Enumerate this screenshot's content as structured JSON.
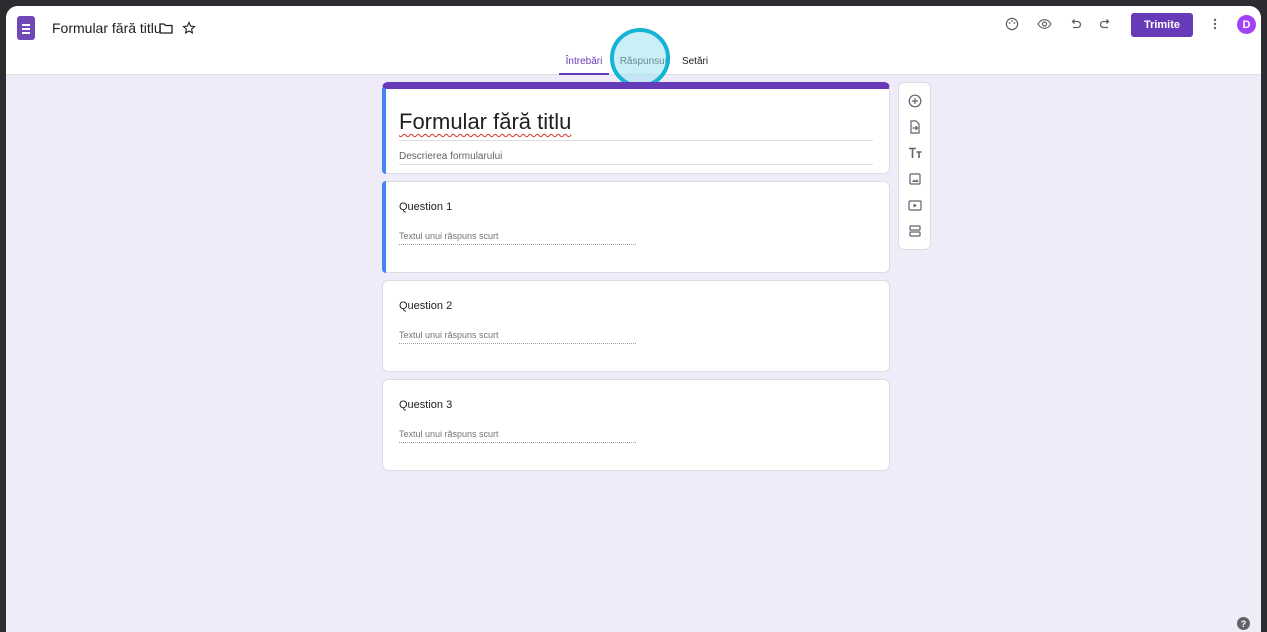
{
  "header": {
    "doc_title": "Formular fără titlu",
    "send_label": "Trimite",
    "avatar_letter": "D",
    "icons": [
      "forms-logo-icon",
      "folder-icon",
      "star-icon",
      "palette-icon",
      "preview-eye-icon",
      "undo-icon",
      "redo-icon",
      "more-vert-icon"
    ]
  },
  "tabs": [
    {
      "label": "Întrebări",
      "active": true
    },
    {
      "label": "Răspunsuri",
      "active": false
    },
    {
      "label": "Setări",
      "active": false
    }
  ],
  "form": {
    "title": "Formular fără titlu",
    "description_placeholder": "Descrierea formularului"
  },
  "questions": [
    {
      "label": "Question 1",
      "answer_placeholder": "Textul unui răspuns scurt"
    },
    {
      "label": "Question 2",
      "answer_placeholder": "Textul unui răspuns scurt"
    },
    {
      "label": "Question 3",
      "answer_placeholder": "Textul unui răspuns scurt"
    }
  ],
  "toolbar": [
    "add-question-icon",
    "import-questions-icon",
    "add-title-icon",
    "add-image-icon",
    "add-video-icon",
    "add-section-icon"
  ],
  "help_glyph": "?",
  "colors": {
    "accent": "#673ab7",
    "highlight": "#15b3d4",
    "background": "#f0ebf8",
    "focus_bar": "#4285f4"
  }
}
